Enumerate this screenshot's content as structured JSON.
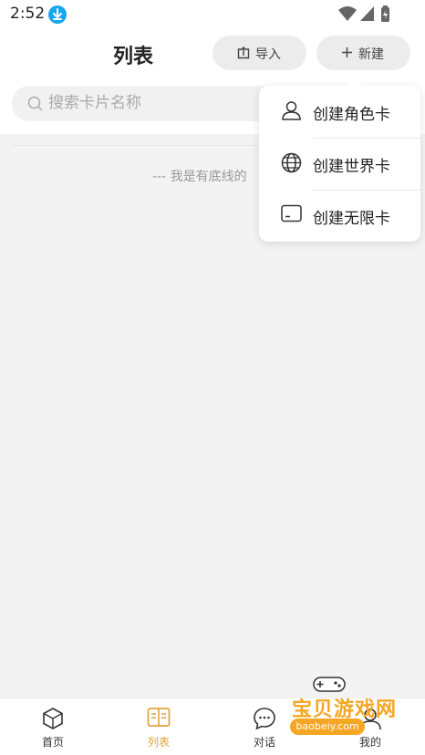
{
  "status_bar": {
    "time": "2:52"
  },
  "header": {
    "title": "列表",
    "import_label": "导入",
    "new_label": "新建"
  },
  "search": {
    "placeholder": "搜索卡片名称"
  },
  "content": {
    "end_text": "--- 我是有底线的"
  },
  "dropdown": {
    "items": [
      {
        "label": "创建角色卡",
        "icon": "person-icon"
      },
      {
        "label": "创建世界卡",
        "icon": "globe-icon"
      },
      {
        "label": "创建无限卡",
        "icon": "card-icon"
      }
    ]
  },
  "tabbar": {
    "tabs": [
      {
        "label": "首页",
        "icon": "home-cube-icon",
        "active": false
      },
      {
        "label": "列表",
        "icon": "list-book-icon",
        "active": true
      },
      {
        "label": "对话",
        "icon": "chat-bubble-icon",
        "active": false
      },
      {
        "label": "我的",
        "icon": "profile-icon",
        "active": false
      }
    ]
  },
  "watermark": {
    "text": "宝贝游戏网",
    "sub": "baobeiy.com"
  },
  "colors": {
    "accent": "#e0a33a",
    "download_badge": "#1aa5f0",
    "watermark": "#f5a623"
  }
}
